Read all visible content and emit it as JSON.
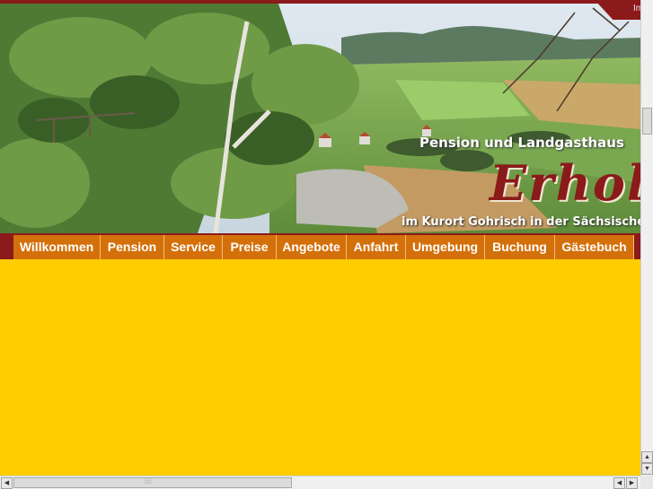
{
  "header": {
    "impressum": "Im",
    "tagline_top": "Pension und Landgasthaus",
    "brand": "Erhol",
    "tagline_bottom": "im Kurort Gohrisch in der Sächsische"
  },
  "nav": {
    "items": [
      {
        "label": "Willkommen"
      },
      {
        "label": "Pension"
      },
      {
        "label": "Service"
      },
      {
        "label": "Preise"
      },
      {
        "label": "Angebote"
      },
      {
        "label": "Anfahrt"
      },
      {
        "label": "Umgebung"
      },
      {
        "label": "Buchung"
      },
      {
        "label": "Gästebuch"
      }
    ]
  },
  "scrollbars": {
    "up": "▲",
    "down": "▼",
    "left": "◀",
    "right": "▶",
    "grip": "⁞⁞⁞⁞"
  },
  "colors": {
    "page_bg": "#ffcc00",
    "brand_red": "#8b1a1a",
    "nav_orange": "#d4700a"
  }
}
